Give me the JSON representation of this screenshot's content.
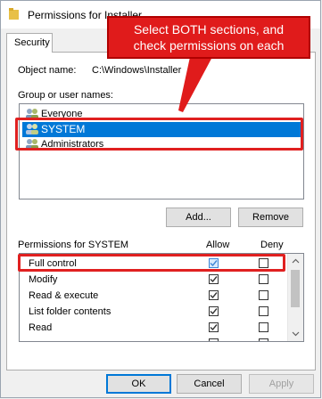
{
  "window": {
    "title": "Permissions for Installer"
  },
  "tabs": [
    {
      "label": "Security"
    }
  ],
  "object": {
    "label": "Object name:",
    "value": "C:\\Windows\\Installer"
  },
  "groups": {
    "label": "Group or user names:",
    "items": [
      {
        "name": "Everyone",
        "selected": false
      },
      {
        "name": "SYSTEM",
        "selected": true
      },
      {
        "name": "Administrators",
        "selected": false
      }
    ]
  },
  "buttons": {
    "add": "Add...",
    "remove": "Remove",
    "ok": "OK",
    "cancel": "Cancel",
    "apply": "Apply"
  },
  "permissions": {
    "label": "Permissions for SYSTEM",
    "allow_header": "Allow",
    "deny_header": "Deny",
    "items": [
      {
        "name": "Full control",
        "allow": true,
        "deny": false
      },
      {
        "name": "Modify",
        "allow": true,
        "deny": false
      },
      {
        "name": "Read & execute",
        "allow": true,
        "deny": false
      },
      {
        "name": "List folder contents",
        "allow": true,
        "deny": false
      },
      {
        "name": "Read",
        "allow": true,
        "deny": false
      }
    ]
  },
  "annotation": {
    "text_line1": "Select BOTH sections, and",
    "text_line2": "check permissions on each"
  },
  "colors": {
    "selection": "#0078d7",
    "annotation_red": "#e01b1b"
  }
}
